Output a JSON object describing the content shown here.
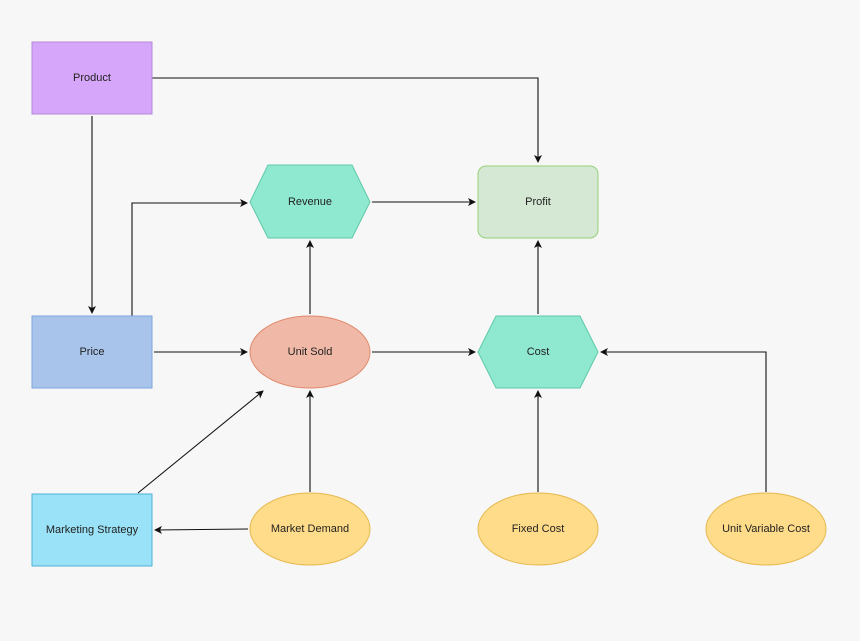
{
  "nodes": {
    "product": {
      "label": "Product",
      "fill": "#d5a6f9"
    },
    "price": {
      "label": "Price",
      "fill": "#a9c4eb"
    },
    "marketing_strategy": {
      "label": "Marketing Strategy",
      "fill": "#99e2f7"
    },
    "revenue": {
      "label": "Revenue",
      "fill": "#8fe9d0"
    },
    "profit": {
      "label": "Profit",
      "fill": "#d5e8d4"
    },
    "unit_sold": {
      "label": "Unit Sold",
      "fill": "#f0b8a6"
    },
    "cost": {
      "label": "Cost",
      "fill": "#8fe9d0"
    },
    "market_demand": {
      "label": "Market Demand",
      "fill": "#ffdc8a"
    },
    "fixed_cost": {
      "label": "Fixed Cost",
      "fill": "#ffdc8a"
    },
    "unit_variable_cost": {
      "label": "Unit Variable Cost",
      "fill": "#ffdc8a"
    }
  },
  "edges": [
    {
      "from": "Product",
      "to": "Profit"
    },
    {
      "from": "Product",
      "to": "Price"
    },
    {
      "from": "Price",
      "to": "Revenue"
    },
    {
      "from": "Price",
      "to": "Unit Sold"
    },
    {
      "from": "Revenue",
      "to": "Profit"
    },
    {
      "from": "Unit Sold",
      "to": "Revenue"
    },
    {
      "from": "Unit Sold",
      "to": "Cost"
    },
    {
      "from": "Cost",
      "to": "Profit"
    },
    {
      "from": "Unit Variable Cost",
      "to": "Cost"
    },
    {
      "from": "Fixed Cost",
      "to": "Cost"
    },
    {
      "from": "Market Demand",
      "to": "Unit Sold"
    },
    {
      "from": "Market Demand",
      "to": "Marketing Strategy"
    },
    {
      "from": "Marketing Strategy",
      "to": "Unit Sold"
    }
  ]
}
